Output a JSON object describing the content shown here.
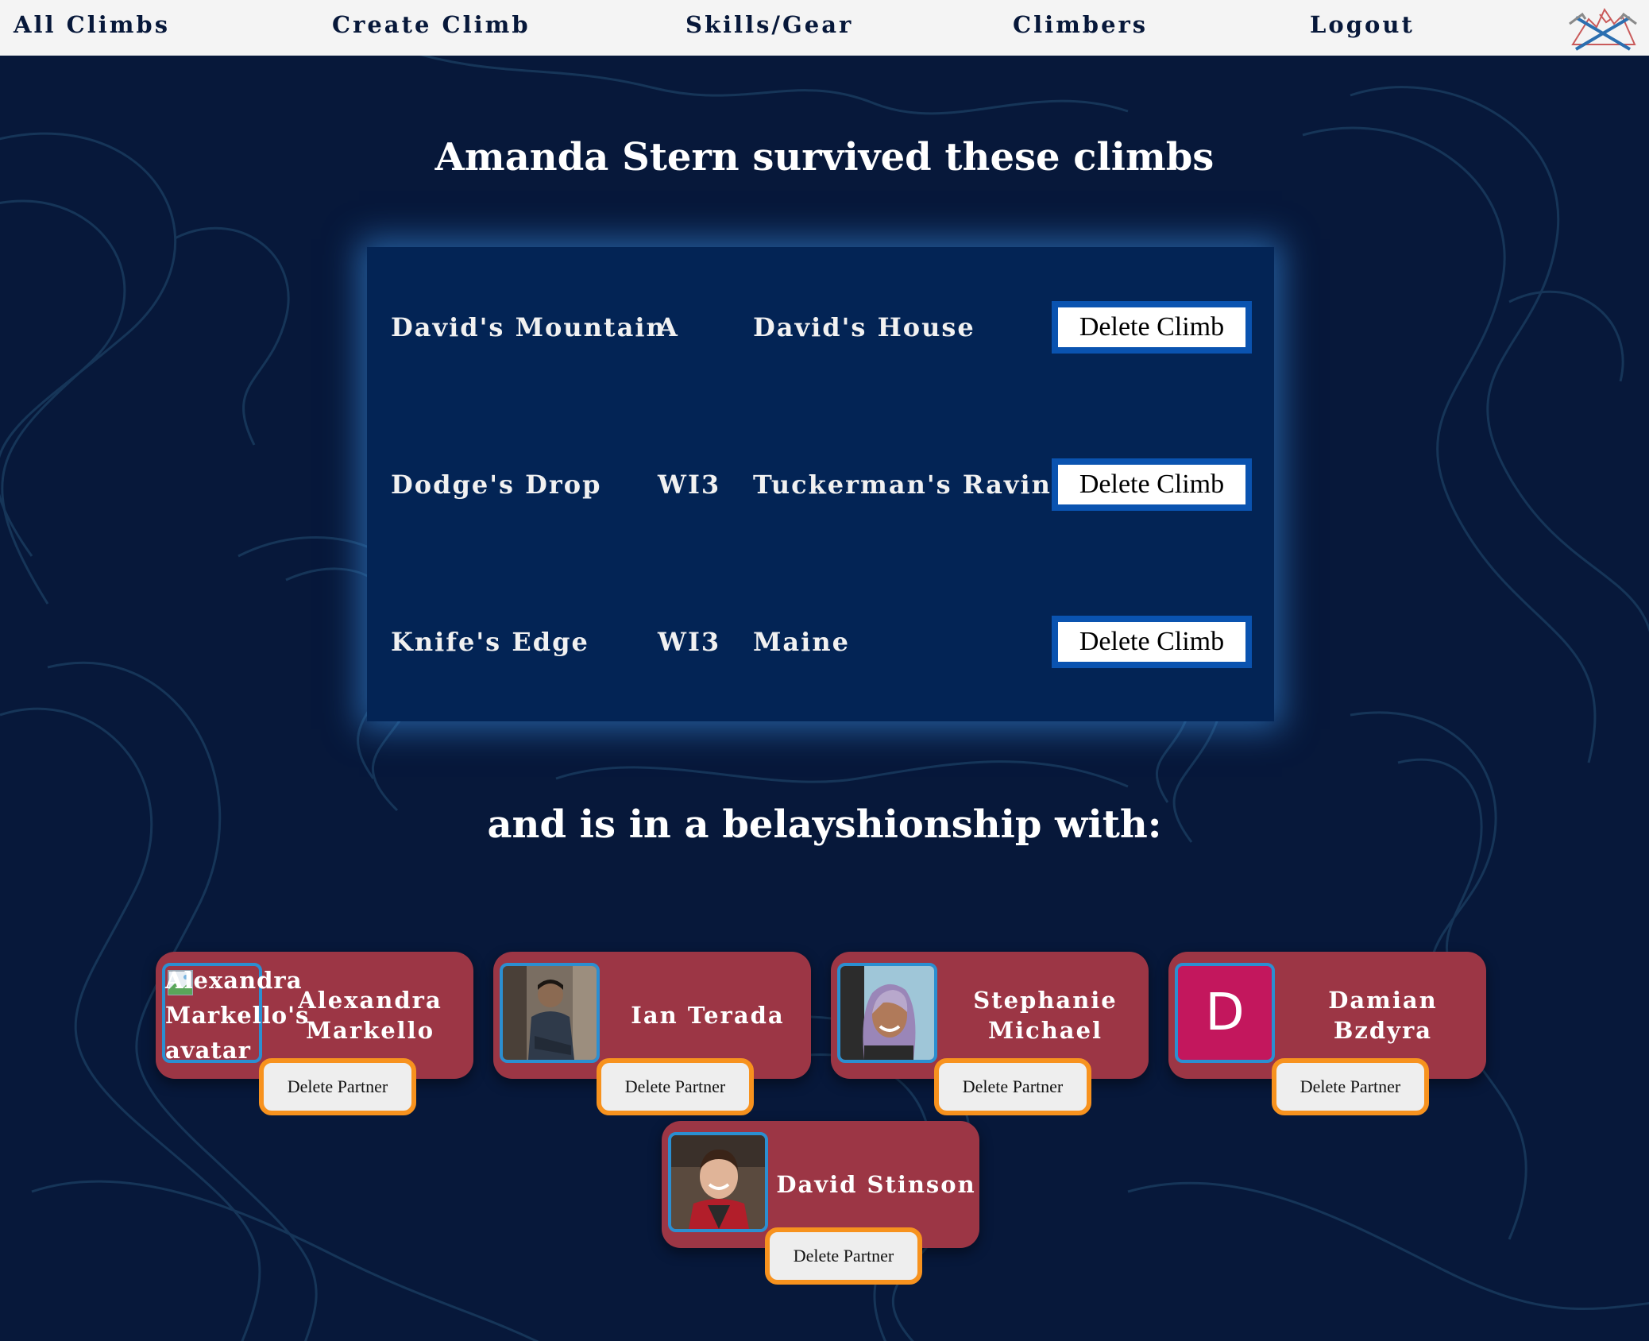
{
  "nav": {
    "links": [
      "All Climbs",
      "Create Climb",
      "Skills/Gear",
      "Climbers",
      "Logout"
    ],
    "logo": "ice-axes-mountain-logo"
  },
  "page_title": "Amanda Stern survived these climbs",
  "climbs": [
    {
      "name": "David's Mountain",
      "grade": "A",
      "location": "David's House",
      "action": "Delete Climb"
    },
    {
      "name": "Dodge's Drop",
      "grade": "WI3",
      "location": "Tuckerman's Ravine",
      "action": "Delete Climb"
    },
    {
      "name": "Knife's Edge",
      "grade": "WI3",
      "location": "Maine",
      "action": "Delete Climb"
    }
  ],
  "subtitle": "and is in a belayshionship with:",
  "partners": [
    {
      "name": "Alexandra Markello",
      "avatar_alt": "Alexandra Markello's avatar",
      "avatar": "broken-image",
      "action": "Delete Partner"
    },
    {
      "name": "Ian Terada",
      "avatar": "photo-ian",
      "action": "Delete Partner"
    },
    {
      "name": "Stephanie Michael",
      "avatar": "photo-stephanie",
      "action": "Delete Partner"
    },
    {
      "name": "Damian Bzdyra",
      "avatar": "initial",
      "initial": "D",
      "action": "Delete Partner"
    },
    {
      "name": "David Stinson",
      "avatar": "photo-david",
      "action": "Delete Partner"
    }
  ],
  "colors": {
    "background": "#07183a",
    "navbar": "#f4f4f4",
    "panel": "#032455",
    "panel_glow": "#3482d2",
    "card": "#9c3645",
    "delete_climb_border": "#0a53b0",
    "delete_partner_border": "#f7921e",
    "avatar_border": "#2b8fd1",
    "initial_avatar": "#c3175d"
  }
}
